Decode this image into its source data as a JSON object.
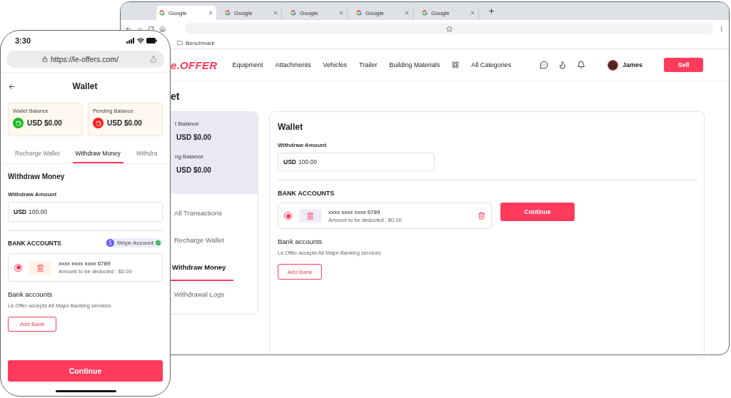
{
  "browser": {
    "tabs": [
      {
        "title": "Google",
        "selected": true
      },
      {
        "title": "Google",
        "selected": false
      },
      {
        "title": "Google",
        "selected": false
      },
      {
        "title": "Google",
        "selected": false
      },
      {
        "title": "Google",
        "selected": false
      }
    ],
    "bookmarks": [
      {
        "label": "Benchmark"
      }
    ],
    "site": {
      "logo": "e.OFFER",
      "nav": [
        "Equipment",
        "Attachments",
        "Vehicles",
        "Trailer",
        "Building Materials"
      ],
      "all_categories": "All Categories",
      "user": "James",
      "sell": "Sell"
    },
    "page_title": "et",
    "sidebar": {
      "balances": [
        {
          "label": "t Balance",
          "amount": "USD $0.00"
        },
        {
          "label": "ng Balance",
          "amount": "USD $0.00"
        }
      ],
      "items": [
        {
          "label": "All Transactions",
          "selected": false
        },
        {
          "label": "Recharge Wallet",
          "selected": false
        },
        {
          "label": "Withdraw Money",
          "selected": true
        },
        {
          "label": "Withdrawal Logs",
          "selected": false
        }
      ]
    },
    "wallet": {
      "title": "Wallet",
      "amount_label": "Withdraw Amount",
      "currency": "USD",
      "amount": "100.00",
      "section": "BANK ACCOUNTS",
      "accounts": [
        {
          "number": "xxxx xxxx xxxx 6789",
          "note": "Amount to be deducted : $0.00",
          "selected": true
        }
      ],
      "continue": "Continue",
      "info_title": "Bank accounts",
      "info_text": "Le.Offer accepts All Major Banking services",
      "add_bank": "Add Bank"
    }
  },
  "phone": {
    "time": "3:30",
    "url": "https://le-offers.com/",
    "title": "Wallet",
    "balances": [
      {
        "label": "Wallet Balance",
        "amount": "USD $0.00",
        "color": "#18b91f"
      },
      {
        "label": "Pending Balance",
        "amount": "USD $0.00",
        "color": "#ff1a1a"
      }
    ],
    "tabs": [
      {
        "label": "Recharge Wallet",
        "selected": false
      },
      {
        "label": "Withdraw Money",
        "selected": true
      },
      {
        "label": "Withdra",
        "selected": false
      }
    ],
    "heading": "Withdraw Money",
    "amount_label": "Withdraw Amount",
    "currency": "USD",
    "amount": "100.00",
    "section": "BANK ACCOUNTS",
    "badge": "Stripe Account",
    "accounts": [
      {
        "number": "xxxx xxxx xxxx 6789",
        "note": "Amount to be deducted : $0.00",
        "selected": true
      }
    ],
    "info_title": "Bank accounts",
    "info_text": "Le.Offer accepts All Major Banking services",
    "add_bank": "Add Bank",
    "continue": "Continue"
  }
}
